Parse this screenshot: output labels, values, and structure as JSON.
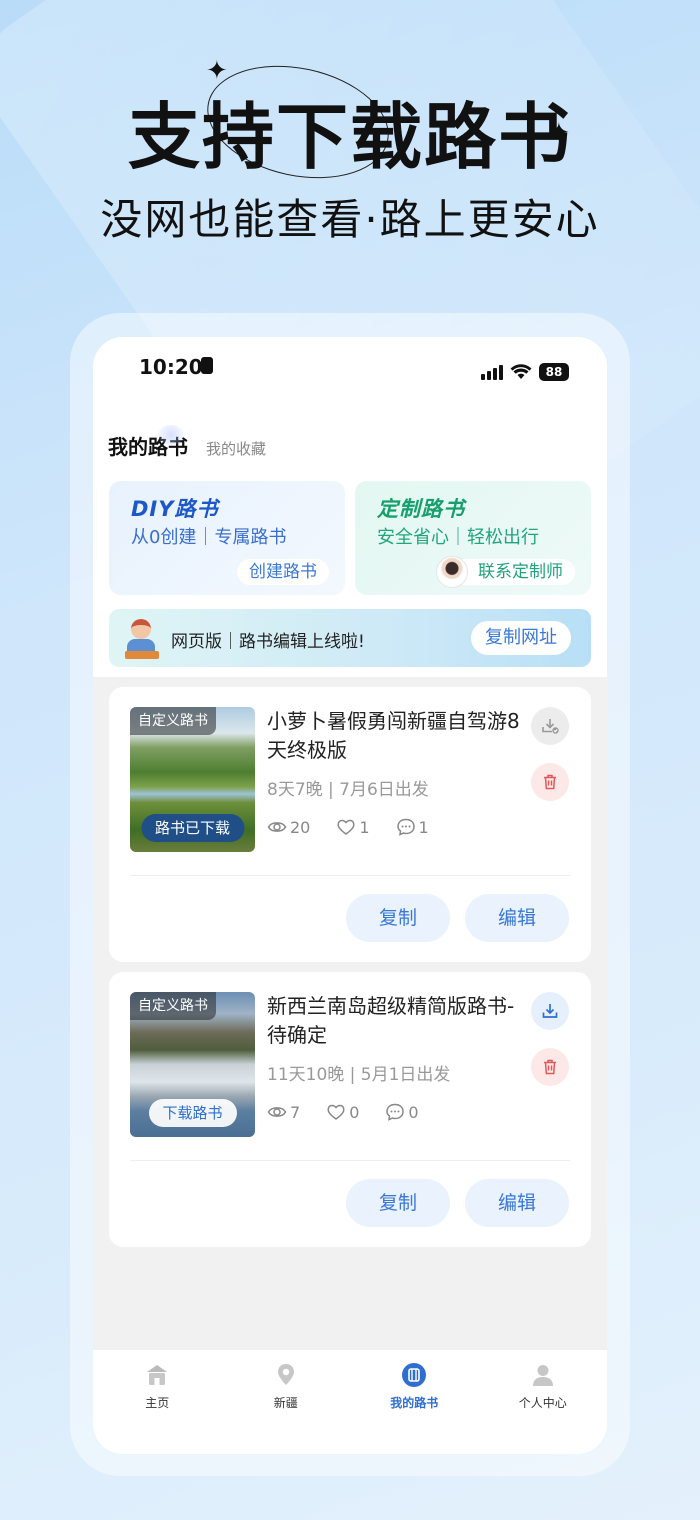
{
  "promo": {
    "headline": "支持下载路书",
    "subhead": "没网也能查看·路上更安心"
  },
  "status_bar": {
    "time": "10:20",
    "battery": "88"
  },
  "tabs": {
    "active": "我的路书",
    "inactive": "我的收藏"
  },
  "cards": {
    "diy": {
      "title": "DIY路书",
      "subtitle": "从0创建｜专属路书",
      "button": "创建路书"
    },
    "custom": {
      "title": "定制路书",
      "subtitle": "安全省心｜轻松出行",
      "button": "联系定制师"
    }
  },
  "banner": {
    "text": "网页版｜路书编辑上线啦!",
    "button": "复制网址"
  },
  "books": [
    {
      "tag": "自定义路书",
      "badge": "路书已下载",
      "title": "小萝卜暑假勇闯新疆自驾游8天终极版",
      "meta": "8天7晚 | 7月6日出发",
      "views": "20",
      "likes": "1",
      "comments": "1",
      "copy": "复制",
      "edit": "编辑",
      "downloaded": true
    },
    {
      "tag": "自定义路书",
      "badge": "下载路书",
      "title": "新西兰南岛超级精简版路书-待确定",
      "meta": "11天10晚 | 5月1日出发",
      "views": "7",
      "likes": "0",
      "comments": "0",
      "copy": "复制",
      "edit": "编辑",
      "downloaded": false
    }
  ],
  "tabbar": {
    "items": [
      {
        "label": "主页",
        "icon": "home-icon"
      },
      {
        "label": "新疆",
        "icon": "location-pin-icon"
      },
      {
        "label": "我的路书",
        "icon": "roadbook-icon",
        "active": true
      },
      {
        "label": "个人中心",
        "icon": "user-icon"
      }
    ]
  },
  "colors": {
    "accent": "#2e6fd0",
    "diy": "#1d58c9",
    "custom": "#17a06e",
    "delete": "#e05858"
  }
}
